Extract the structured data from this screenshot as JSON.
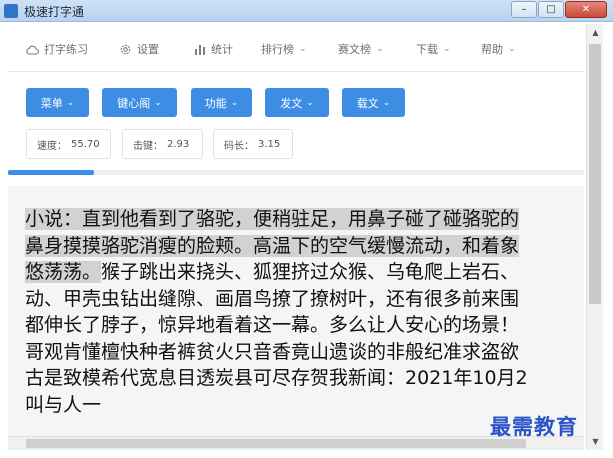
{
  "window": {
    "title": "极速打字通",
    "btn_minimize": "–",
    "btn_restore": "□",
    "btn_close": "✕"
  },
  "nav": [
    {
      "label": "打字练习",
      "icon": "cloud-icon"
    },
    {
      "label": "设置",
      "icon": "gear-icon"
    },
    {
      "label": "统计",
      "icon": "bar-chart-icon"
    },
    {
      "label": "排行榜",
      "icon": "chevron-down-icon"
    },
    {
      "label": "赛文榜",
      "icon": "chevron-down-icon"
    },
    {
      "label": "下载",
      "icon": "chevron-down-icon"
    },
    {
      "label": "帮助",
      "icon": "chevron-down-icon"
    }
  ],
  "toolbar": [
    {
      "label": "菜单"
    },
    {
      "label": "键心阁"
    },
    {
      "label": "功能"
    },
    {
      "label": "发文"
    },
    {
      "label": "载文"
    }
  ],
  "stats": {
    "speed": {
      "label": "速度：",
      "value": "55.70"
    },
    "keystroke": {
      "label": "击键：",
      "value": "2.93"
    },
    "codelen": {
      "label": "码长：",
      "value": "3.15"
    }
  },
  "progress": 0.15,
  "passage": {
    "line1_typed": "小说：直到他看到了骆驼，便稍驻足，用鼻子碰了碰骆驼的",
    "line2_typed": "鼻身摸摸骆驼消瘦的脸颊。高温下的空气缓慢流动，和着象",
    "line3_typed": "悠荡荡。",
    "line3_rest": "猴子跳出来挠头、狐狸挤过众猴、乌龟爬上岩石、",
    "line4": "动、甲壳虫钻出缝隙、画眉鸟撩了撩树叶，还有很多前来围",
    "line5": "都伸长了脖子，惊异地看着这一幕。多么让人安心的场景！",
    "line6": "哥观肯懂檀快种者裤贫火只音香竟山遗谈的非般纪准求盗欲",
    "line7": "古是致模希代宽息目透炭县可尽存贺我新闻：2021年10月2",
    "line8": "叫与人一"
  },
  "watermark": "最需教育",
  "colors": {
    "accent": "#3d8de5",
    "typed_highlight": "#d2d2d2"
  }
}
